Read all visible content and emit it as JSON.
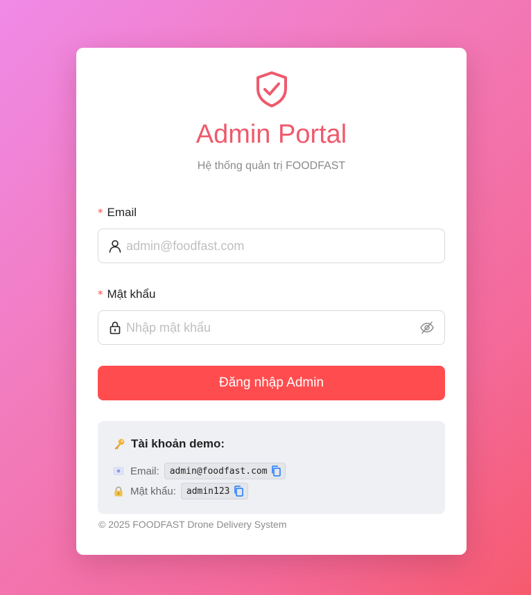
{
  "brand": {
    "title": "Admin Portal",
    "subtitle": "Hệ thống quản trị FOODFAST",
    "accent_color": "#ee5a6c",
    "logo_icon": "shield-check-icon"
  },
  "form": {
    "email": {
      "label": "Email",
      "required_mark": "*",
      "placeholder": "admin@foodfast.com",
      "value": "",
      "icon": "user-icon"
    },
    "password": {
      "label": "Mật khẩu",
      "required_mark": "*",
      "placeholder": "Nhập mật khẩu",
      "value": "",
      "icon": "lock-icon",
      "toggle_icon": "eye-invisible-icon"
    },
    "submit_label": "Đăng nhập Admin",
    "button_color": "#ff4d4f"
  },
  "demo": {
    "title": "Tài khoản demo:",
    "title_icon": "key-icon",
    "email_label": "Email:",
    "email_value": "admin@foodfast.com",
    "password_label": "Mật khẩu:",
    "password_value": "admin123"
  },
  "footer": {
    "text": "© 2025 FOODFAST Drone Delivery System"
  }
}
